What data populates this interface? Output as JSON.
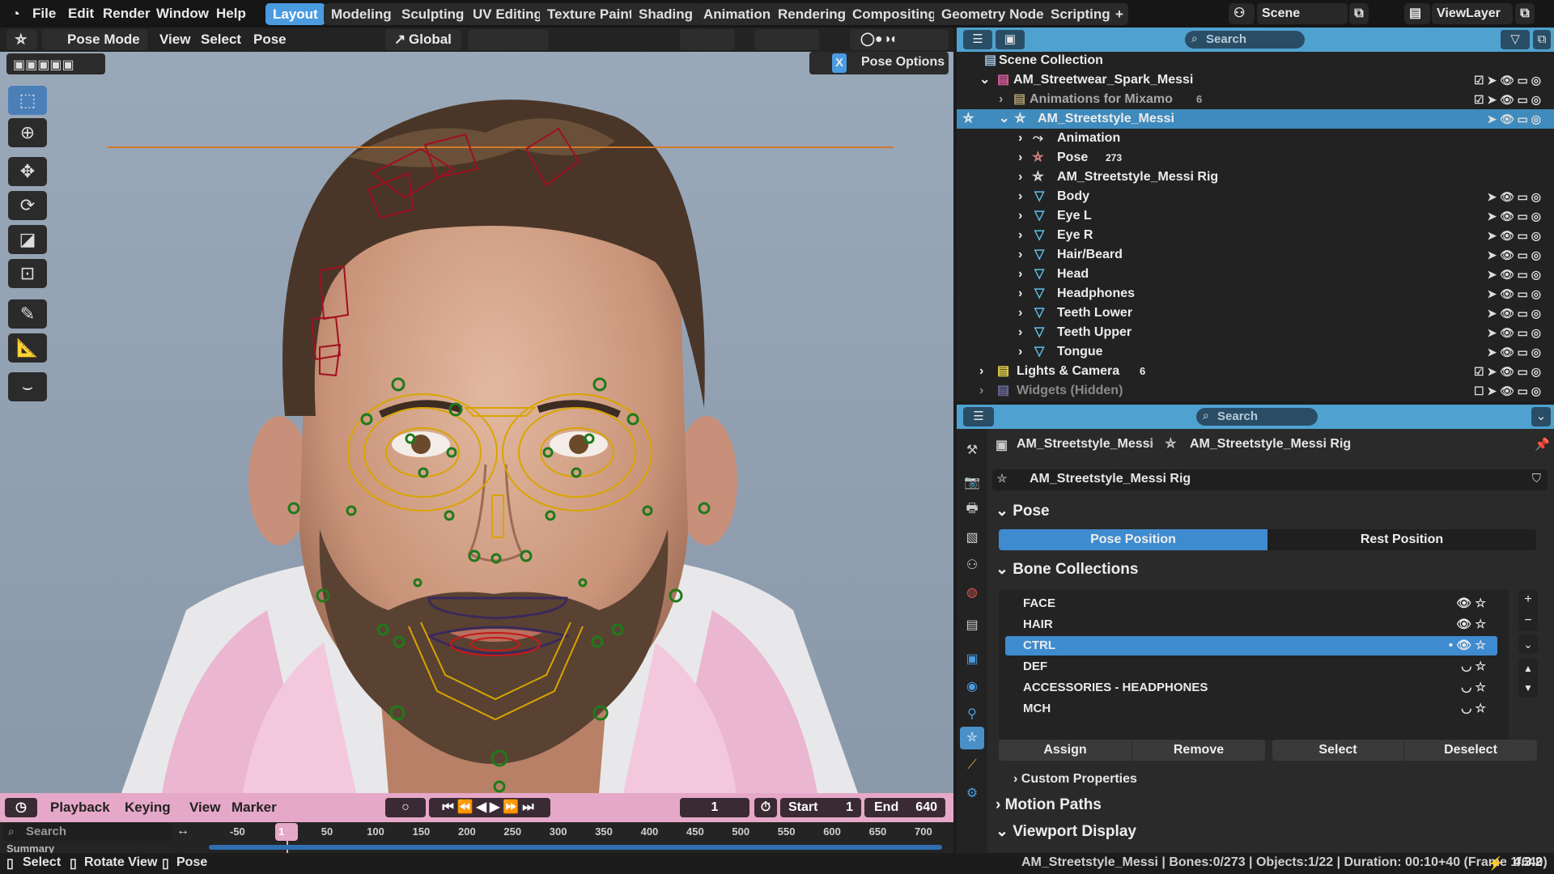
{
  "topbar": {
    "menus": [
      "File",
      "Edit",
      "Render",
      "Window",
      "Help"
    ],
    "workspaces": [
      "Layout",
      "Modeling",
      "Sculpting",
      "UV Editing",
      "Texture Paint",
      "Shading",
      "Animation",
      "Rendering",
      "Compositing",
      "Geometry Nodes",
      "Scripting"
    ],
    "active_workspace": "Layout",
    "add_tab": "+",
    "scene": "Scene",
    "view_layer": "ViewLayer"
  },
  "viewport_header": {
    "mode": "Pose Mode",
    "menus": [
      "View",
      "Select",
      "Pose"
    ],
    "orientation": "Global",
    "pose_options": "Pose Options",
    "x_mirror": "X"
  },
  "outliner": {
    "search_placeholder": "Search",
    "rows": [
      {
        "label": "Scene Collection",
        "badge": ""
      },
      {
        "label": "AM_Streetwear_Spark_Messi",
        "badge": ""
      },
      {
        "label": "Animations for Mixamo",
        "badge": "6"
      },
      {
        "label": "AM_Streetstyle_Messi",
        "badge": ""
      },
      {
        "label": "Animation",
        "badge": ""
      },
      {
        "label": "Pose",
        "badge": "273"
      },
      {
        "label": "AM_Streetstyle_Messi Rig",
        "badge": ""
      },
      {
        "label": "Body",
        "badge": ""
      },
      {
        "label": "Eye L",
        "badge": ""
      },
      {
        "label": "Eye R",
        "badge": ""
      },
      {
        "label": "Hair/Beard",
        "badge": ""
      },
      {
        "label": "Head",
        "badge": ""
      },
      {
        "label": "Headphones",
        "badge": ""
      },
      {
        "label": "Teeth Lower",
        "badge": ""
      },
      {
        "label": "Teeth Upper",
        "badge": ""
      },
      {
        "label": "Tongue",
        "badge": ""
      },
      {
        "label": "Lights & Camera",
        "badge": "6"
      },
      {
        "label": "Widgets (Hidden)",
        "badge": ""
      }
    ]
  },
  "properties": {
    "search_placeholder": "Search",
    "breadcrumb_object": "AM_Streetstyle_Messi",
    "breadcrumb_data": "AM_Streetstyle_Messi Rig",
    "datablock_name": "AM_Streetstyle_Messi Rig",
    "pose_section": "Pose",
    "pose_position": "Pose Position",
    "rest_position": "Rest Position",
    "bone_collections_section": "Bone Collections",
    "bone_collections": [
      "FACE",
      "HAIR",
      "CTRL",
      "DEF",
      "ACCESSORIES - HEADPHONES",
      "MCH"
    ],
    "selected_collection": "CTRL",
    "buttons": [
      "Assign",
      "Remove",
      "Select",
      "Deselect"
    ],
    "custom_properties": "Custom Properties",
    "motion_paths": "Motion Paths",
    "viewport_display": "Viewport Display"
  },
  "timeline": {
    "menus": [
      "Playback",
      "Keying",
      "View",
      "Marker"
    ],
    "current_frame": "1",
    "start_label": "Start",
    "start": "1",
    "end_label": "End",
    "end": "640",
    "search_placeholder": "Search",
    "summary": "Summary",
    "ticks": [
      "-50",
      "1",
      "50",
      "100",
      "150",
      "200",
      "250",
      "300",
      "350",
      "400",
      "450",
      "500",
      "550",
      "600",
      "650",
      "700"
    ]
  },
  "statusbar": {
    "select": "Select",
    "rotate_view": "Rotate View",
    "pose": "Pose",
    "info": "AM_Streetstyle_Messi | Bones:0/273 | Objects:1/22 | Duration: 00:10+40 (Frame 1/640)",
    "version": "4.3.2"
  },
  "colors": {
    "accent": "#4a9be0",
    "outliner_header": "#4fa2d0",
    "timeline_header": "#e6a8c8",
    "viewport_bg": "#8f9fb1",
    "face_bone": "#d9a400",
    "ctrl_bone": "#2a8a20",
    "hair_bone": "#b01020"
  }
}
